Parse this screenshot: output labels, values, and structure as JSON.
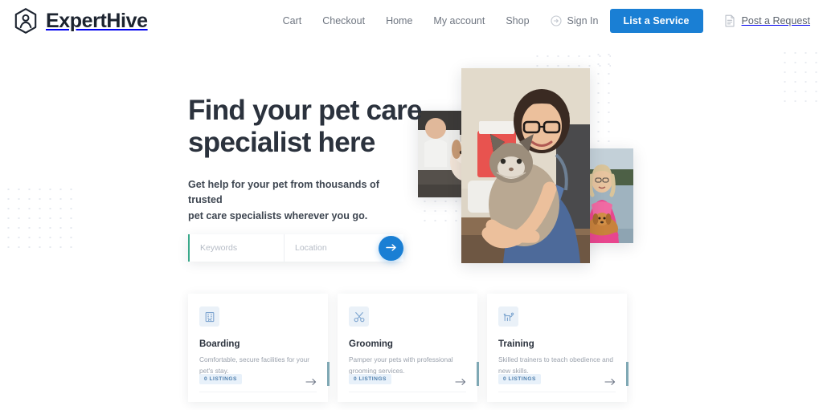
{
  "header": {
    "brand": {
      "name": "ExpertHive",
      "logo_icon": "hexagon-user-icon"
    },
    "nav": [
      {
        "label": "Cart",
        "name": "nav-cart"
      },
      {
        "label": "Checkout",
        "name": "nav-checkout"
      },
      {
        "label": "Home",
        "name": "nav-home"
      },
      {
        "label": "My account",
        "name": "nav-my-account"
      },
      {
        "label": "Shop",
        "name": "nav-shop"
      }
    ],
    "sign_in": {
      "label": "Sign In",
      "icon": "arrow-circle-right-icon"
    },
    "list_service_button": {
      "label": "List a Service",
      "color": "#1a7fd4"
    },
    "post_request": {
      "label": "Post a Request",
      "icon": "document-icon"
    }
  },
  "hero": {
    "title_line1": "Find your pet care",
    "title_line2": "specialist here",
    "subtitle_line1": "Get help for your pet from thousands of trusted",
    "subtitle_line2": "pet care specialists wherever you go.",
    "photos": [
      {
        "name": "photo-person-with-puppy",
        "alt": "Person holding a puppy in a car"
      },
      {
        "name": "photo-vet-with-cat",
        "alt": "Smiling veterinarian in blue scrubs holding a fluffy cat"
      },
      {
        "name": "photo-woman-with-dog",
        "alt": "Woman in pink jacket holding a dachshund by a lake"
      }
    ]
  },
  "search": {
    "keywords_placeholder": "Keywords",
    "keywords_value": "",
    "location_placeholder": "Location",
    "location_value": "",
    "location_icon": "locate-arrow-icon",
    "submit_icon": "arrow-right-icon",
    "accent_color": "#3aa98a"
  },
  "categories": [
    {
      "icon": "building-icon",
      "title": "Boarding",
      "description": "Comfortable, secure facilities for your pet's stay.",
      "listings": "0 LISTINGS",
      "arrow_icon": "arrow-right-icon"
    },
    {
      "icon": "scissors-icon",
      "title": "Grooming",
      "description": "Pamper your pets with professional grooming services.",
      "listings": "0 LISTINGS",
      "arrow_icon": "arrow-right-icon"
    },
    {
      "icon": "dog-icon",
      "title": "Training",
      "description": "Skilled trainers to teach obedience and new skills.",
      "listings": "0 LISTINGS",
      "arrow_icon": "arrow-right-icon"
    }
  ]
}
